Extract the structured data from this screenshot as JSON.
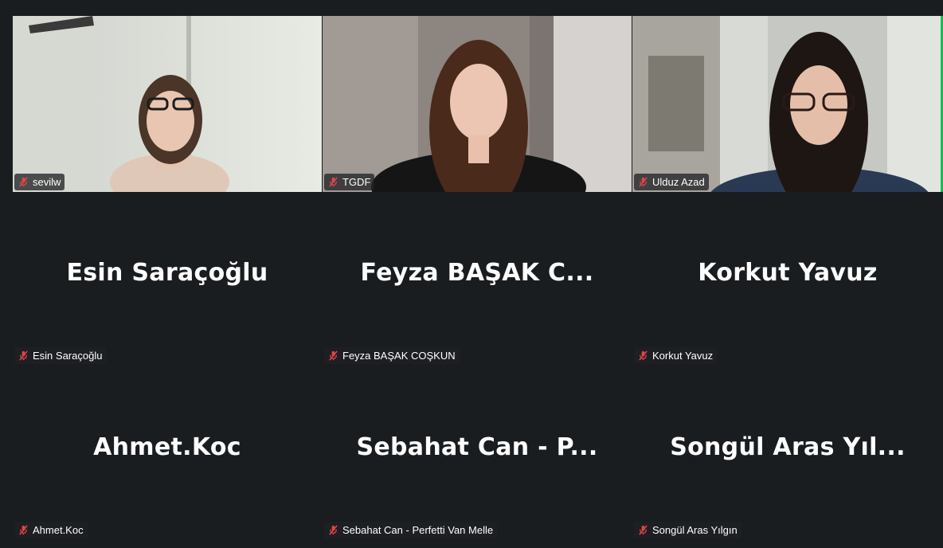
{
  "participants": [
    {
      "label": "sevilw",
      "big_name": "",
      "video": true,
      "mic": "mic-muted-icon"
    },
    {
      "label": "TGDF",
      "big_name": "",
      "video": true,
      "mic": "mic-muted-icon"
    },
    {
      "label": "Ulduz Azad",
      "big_name": "",
      "video": true,
      "mic": "mic-muted-icon"
    },
    {
      "label": "Esin Saraçoğlu",
      "big_name": "Esin Saraçoğlu",
      "video": false,
      "mic": "mic-muted-icon"
    },
    {
      "label": "Feyza BAŞAK COŞKUN",
      "big_name": "Feyza BAŞAK C...",
      "video": false,
      "mic": "mic-muted-icon"
    },
    {
      "label": "Korkut Yavuz",
      "big_name": "Korkut Yavuz",
      "video": false,
      "mic": "mic-muted-icon"
    },
    {
      "label": "Ahmet.Koc",
      "big_name": "Ahmet.Koc",
      "video": false,
      "mic": "mic-muted-icon"
    },
    {
      "label": "Sebahat Can - Perfetti Van Melle",
      "big_name": "Sebahat Can - P...",
      "video": false,
      "mic": "mic-muted-icon"
    },
    {
      "label": "Songül Aras Yılgın",
      "big_name": "Songül Aras Yıl...",
      "video": false,
      "mic": "mic-muted-icon"
    }
  ],
  "colors": {
    "background": "#1a1d20",
    "label_bg": "#1e2023",
    "mute_icon": "#e0444a",
    "active_speaker": "#1db954"
  }
}
